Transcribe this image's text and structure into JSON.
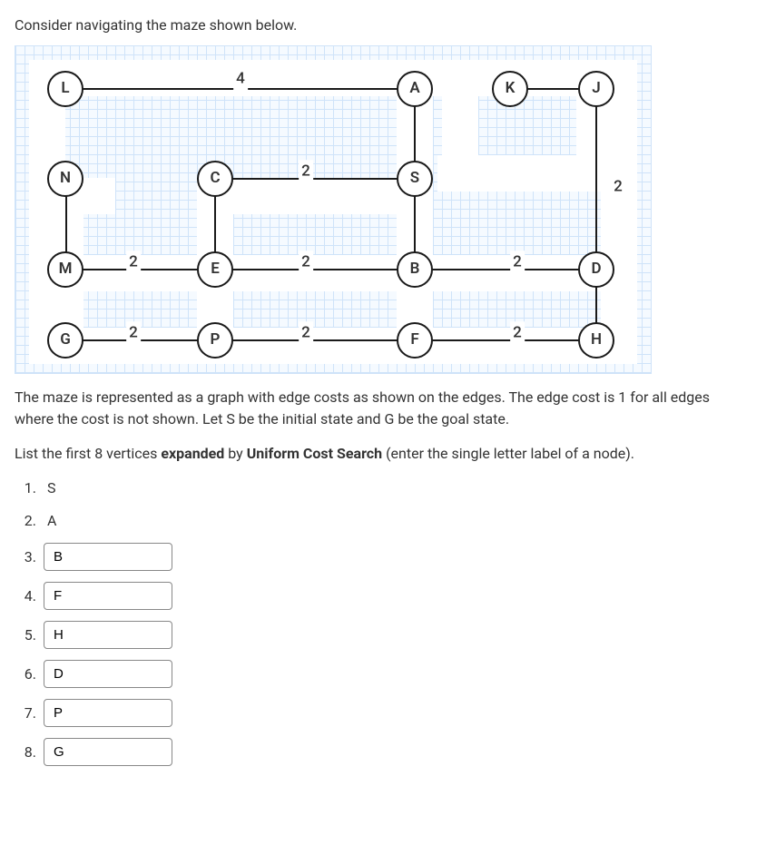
{
  "prompt": "Consider navigating the maze shown below.",
  "maze": {
    "nodes": {
      "L": "L",
      "A": "A",
      "K": "K",
      "J": "J",
      "N": "N",
      "C": "C",
      "S": "S",
      "M": "M",
      "E": "E",
      "B": "B",
      "D": "D",
      "G": "G",
      "P": "P",
      "F": "F",
      "H": "H"
    },
    "edge_labels": {
      "LA": "4",
      "CS": "2",
      "JD": "2",
      "ME": "2",
      "EB": "2",
      "BD": "2",
      "GP": "2",
      "PF": "2",
      "FH": "2"
    }
  },
  "desc1": "The maze is represented as a graph with edge costs as shown on the edges. The edge cost is 1 for all edges where the cost is not shown.  Let S be the initial state and G be the goal state.",
  "desc2_pre": "List the first 8 vertices ",
  "desc2_b1": "expanded",
  "desc2_mid": " by ",
  "desc2_b2": "Uniform Cost Search",
  "desc2_post": " (enter the single letter label of a node).",
  "answers": {
    "n1": "1.",
    "g1": "S",
    "n2": "2.",
    "g2": "A",
    "n3": "3.",
    "v3": "B",
    "n4": "4.",
    "v4": "F",
    "n5": "5.",
    "v5": "H",
    "n6": "6.",
    "v6": "D",
    "n7": "7.",
    "v7": "P",
    "n8": "8.",
    "v8": "G"
  }
}
